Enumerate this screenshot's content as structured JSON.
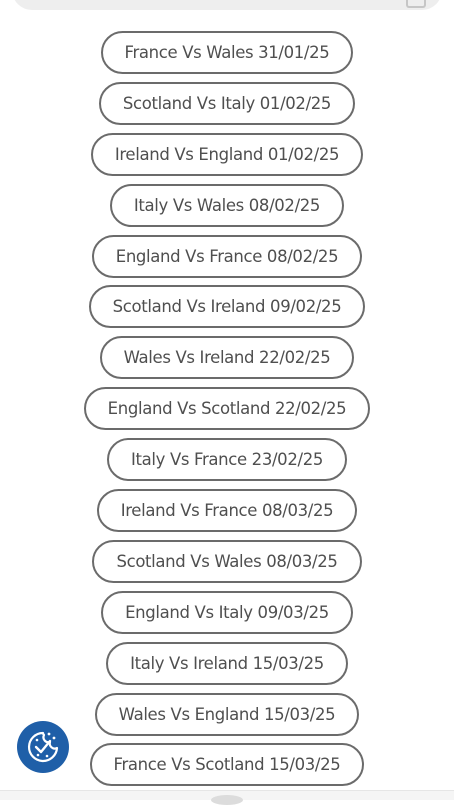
{
  "colors": {
    "button_border": "#6b6b6b",
    "button_text": "#4f4f4f",
    "cookie_button_bg": "#1f5fa8",
    "search_bar_bg": "#eeeeee"
  },
  "icons": {
    "search": "search-icon",
    "cookie": "cookie-consent-icon"
  },
  "matches": [
    {
      "label": "France Vs Wales 31/01/25"
    },
    {
      "label": "Scotland Vs Italy 01/02/25"
    },
    {
      "label": "Ireland Vs England 01/02/25"
    },
    {
      "label": "Italy Vs Wales 08/02/25"
    },
    {
      "label": "England Vs France 08/02/25"
    },
    {
      "label": "Scotland Vs Ireland 09/02/25"
    },
    {
      "label": "Wales Vs Ireland 22/02/25"
    },
    {
      "label": "England Vs Scotland 22/02/25"
    },
    {
      "label": "Italy Vs France 23/02/25"
    },
    {
      "label": "Ireland Vs France 08/03/25"
    },
    {
      "label": "Scotland Vs Wales 08/03/25"
    },
    {
      "label": "England Vs Italy 09/03/25"
    },
    {
      "label": "Italy Vs Ireland 15/03/25"
    },
    {
      "label": "Wales Vs England 15/03/25"
    },
    {
      "label": "France Vs Scotland 15/03/25"
    }
  ]
}
